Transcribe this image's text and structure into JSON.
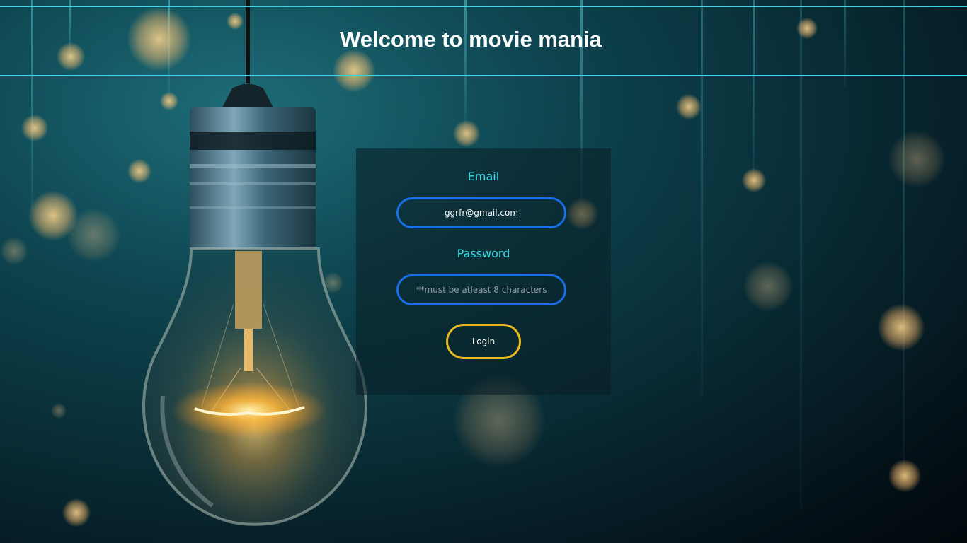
{
  "header": {
    "title": "Welcome to movie mania"
  },
  "login_form": {
    "email_label": "Email",
    "email_value": "ggrfr@gmail.com",
    "password_label": "Password",
    "password_placeholder": "**must be atleast 8 characters",
    "login_button_label": "Login"
  },
  "colors": {
    "header_line": "#35d5e3",
    "label_text": "#35e0ea",
    "input_border": "#1a6fe6",
    "button_border": "#e8b81e"
  },
  "background": {
    "image_subject": "light-bulb-icon"
  }
}
